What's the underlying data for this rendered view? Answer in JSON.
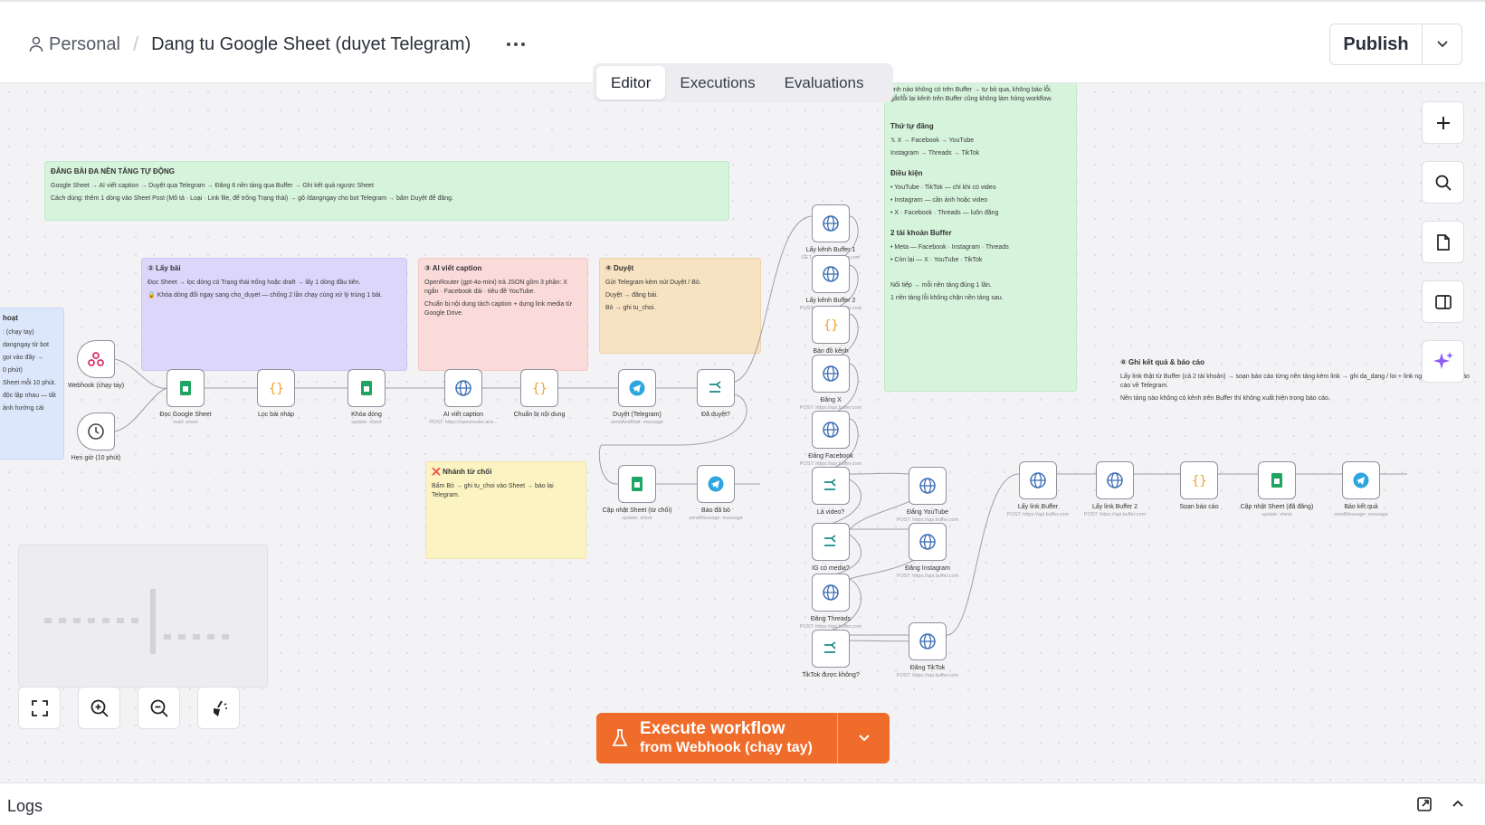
{
  "header": {
    "project": "Personal",
    "workflow_title": "Dang tu Google Sheet (duyet Telegram)",
    "publish_label": "Publish"
  },
  "tabs": [
    {
      "label": "Editor",
      "active": true
    },
    {
      "label": "Executions",
      "active": false
    },
    {
      "label": "Evaluations",
      "active": false
    }
  ],
  "notes": {
    "main": {
      "title": "ĐĂNG BÀI ĐA NỀN TẢNG TỰ ĐỘNG",
      "line1": "Google Sheet → AI viết caption → Duyệt qua Telegram → Đăng 6 nền tảng qua Buffer → Ghi kết quả ngược Sheet",
      "line2": "Cách dùng: thêm 1 dòng vào Sheet Post (Mô tả · Loại · Link file, để trống Trạng thái) → gõ /dangngay cho bot Telegram → bấm Duyệt để đăng."
    },
    "trigger": {
      "title": "hoạt",
      "line1": ": (chạy tay)",
      "line2": "dangngay từ bot",
      "line3": "gọi vào đây →",
      "line4": "0 phút)",
      "line5": "Sheet mỗi 10 phút.",
      "line6": "độc lập nhau — tất",
      "line7": "ảnh hưởng cái"
    },
    "step2": {
      "title": "② Lấy bài",
      "line1": "Đọc Sheet → lọc dòng có Trạng thái trống hoặc draft → lấy 1 dòng đầu tiên.",
      "line2": "🔒 Khóa dòng đổi ngay sang cho_duyet — chống 2 lần chạy cùng xử lý trùng 1 bài."
    },
    "step3": {
      "title": "③ AI viết caption",
      "line1": "OpenRouter (gpt-4o-mini) trả JSON gồm 3 phần: X ngắn · Facebook dài · tiêu đề YouTube.",
      "line2": "Chuẩn bị nội dung tách caption + dựng link media từ Google Drive."
    },
    "step4": {
      "title": "④ Duyệt",
      "line1": "Gửi Telegram kèm nút Duyệt / Bỏ.",
      "line2": "Duyệt → đăng bài.",
      "line3": "Bỏ → ghi tu_choi."
    },
    "reject": {
      "title": "❌ Nhánh từ chối",
      "line1": "Bấm Bỏ → ghi tu_choi vào Sheet → báo lại Telegram."
    },
    "channels": {
      "line0": "ênh nào không có trên Buffer → tự bỏ qua, không báo lỗi. gắt/lỗi lại kênh trên Buffer cũng không làm hỏng workflow.",
      "order_title": "Thứ tự đăng",
      "order1": "𝕏 X → Facebook → YouTube",
      "order2": "Instagram → Threads → TikTok",
      "cond_title": "Điều kiện",
      "cond1": "• YouTube · TikTok — chỉ khi có video",
      "cond2": "• Instagram — cần ảnh hoặc video",
      "cond3": "• X · Facebook · Threads — luôn đăng",
      "acc_title": "2 tài khoản Buffer",
      "acc1": "• Meta — Facebook · Instagram · Threads",
      "acc2": "• Còn lại — X · YouTube · TikTok",
      "foot1": "Nối tiếp → mỗi nền tảng đúng 1 lần.",
      "foot2": "1 nền tảng lỗi không chặn nền tảng sau."
    },
    "step6": {
      "title": "⑥ Ghi kết quả & báo cáo",
      "line1": "Lấy link thật từ Buffer (cả 2 tài khoản) → soạn báo cáo từng nền tảng kèm link → ghi da_dang / loi + link ngược Sheet + báo cáo về Telegram.",
      "line2": "Nền tảng nào không có kênh trên Buffer thì không xuất hiện trong báo cáo."
    }
  },
  "nodes": {
    "webhook": {
      "label": "Webhook (chạy tay)",
      "sub": "POST"
    },
    "schedule": {
      "label": "Hẹn giờ (10 phút)"
    },
    "read_sheet": {
      "label": "Đọc Google Sheet",
      "sub": "read: sheet"
    },
    "filter": {
      "label": "Lọc bài nháp"
    },
    "lock_row": {
      "label": "Khóa dòng",
      "sub": "update: sheet"
    },
    "ai_caption": {
      "label": "AI viết caption",
      "sub": "POST: https://openrouter.ai/a..."
    },
    "prepare": {
      "label": "Chuẩn bị nội dung"
    },
    "approve_tg": {
      "label": "Duyệt (Telegram)",
      "sub": "sendAndWait: message"
    },
    "approved": {
      "label": "Đã duyệt?",
      "true": "true",
      "false": "false"
    },
    "update_reject": {
      "label": "Cập nhật Sheet (từ chối)",
      "sub": "update: sheet"
    },
    "report_skip": {
      "label": "Báo đã bỏ",
      "sub": "sendMessage: message"
    },
    "buffer1": {
      "label": "Lấy kênh Buffer 1",
      "sub": "GET: https://api.buffer.com"
    },
    "buffer2": {
      "label": "Lấy kênh Buffer 2",
      "sub": "POST: https://api.buffer.com"
    },
    "map_channels": {
      "label": "Bản đồ kênh"
    },
    "post_x": {
      "label": "Đăng X",
      "sub": "POST: https://api.buffer.com"
    },
    "post_fb": {
      "label": "Đăng Facebook",
      "sub": "POST: https://api.buffer.com"
    },
    "is_video": {
      "label": "Là video?"
    },
    "ig_media": {
      "label": "IG có media?"
    },
    "post_threads": {
      "label": "Đăng Threads",
      "sub": "POST: https://api.buffer.com"
    },
    "tiktok_ok": {
      "label": "TikTok được không?"
    },
    "post_yt": {
      "label": "Đăng YouTube",
      "sub": "POST: https://api.buffer.com"
    },
    "post_ig": {
      "label": "Đăng Instagram",
      "sub": "POST: https://api.buffer.com"
    },
    "post_tiktok": {
      "label": "Đăng TikTok",
      "sub": "POST: https://api.buffer.com"
    },
    "link_buffer1": {
      "label": "Lấy link Buffer",
      "sub": "POST: https://api.buffer.com"
    },
    "link_buffer2": {
      "label": "Lấy link Buffer 2",
      "sub": "POST: https://api.buffer.com"
    },
    "compose_report": {
      "label": "Soạn báo cáo"
    },
    "update_done": {
      "label": "Cập nhật Sheet (đã đăng)",
      "sub": "update: sheet"
    },
    "report_result": {
      "label": "Báo kết quả",
      "sub": "sendMessage: message"
    }
  },
  "execute": {
    "line1": "Execute workflow",
    "line2": "from Webhook (chạy tay)"
  },
  "logs": {
    "label": "Logs"
  },
  "colors": {
    "accent": "#ef6c2b",
    "sheets_green": "#1fa463",
    "telegram_blue": "#2ca5e0",
    "code_orange": "#f0a22b",
    "http_blue": "#3d6fb5",
    "ai_purple": "#8b5cf6"
  }
}
